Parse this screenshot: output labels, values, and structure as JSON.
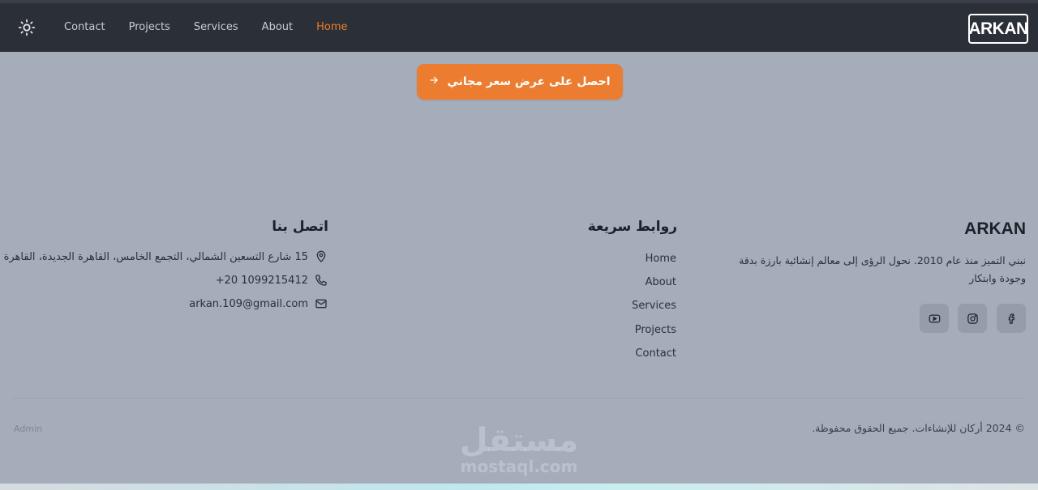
{
  "header": {
    "nav": [
      "Contact",
      "Projects",
      "Services",
      "About",
      "Home"
    ],
    "active_nav": "Home",
    "brand": "ARKAN",
    "theme_icon": "sun-icon"
  },
  "cta": {
    "label": "احصل على عرض سعر مجاني",
    "icon": "arrow-right-icon"
  },
  "footer": {
    "brand": {
      "name": "ARKAN",
      "description": "نبني التميز منذ عام 2010. نحول الرؤى إلى معالم إنشائية بارزة بدقة وجودة وابتكار",
      "social_icons": [
        "youtube-icon",
        "instagram-icon",
        "facebook-icon"
      ]
    },
    "quick_links": {
      "title": "روابط سريعة",
      "items": [
        "Home",
        "About",
        "Services",
        "Projects",
        "Contact"
      ]
    },
    "contact": {
      "title": "اتصل بنا",
      "address": "15 شارع التسعين الشمالي، التجمع الخامس، القاهرة الجديدة، القاهرة",
      "phone": "+20 1099215412",
      "email": "arkan.109@gmail.com"
    },
    "admin_label": "Admin",
    "copyright": "© 2024 أركان للإنشاءات. جميع الحقوق محفوظة."
  },
  "watermark": {
    "arabic": "مستقل",
    "latin": "mostaql.com"
  },
  "colors": {
    "accent": "#ec7d30",
    "header_bg": "#2b2f37",
    "page_bg": "#a5adbb"
  }
}
